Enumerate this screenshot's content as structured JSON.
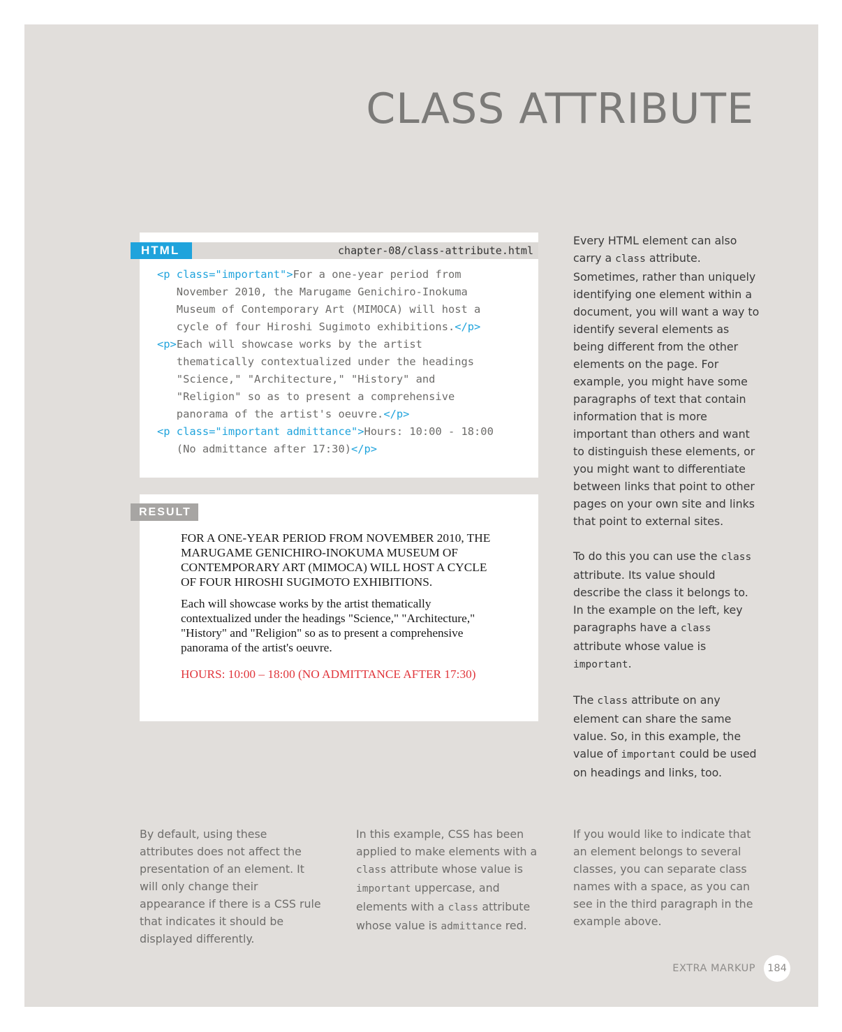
{
  "title": "CLASS ATTRIBUTE",
  "html_panel": {
    "label": "HTML",
    "filename": "chapter-08/class-attribute.html",
    "code_lines": [
      [
        {
          "t": "<p class=\"important\">",
          "tag": true
        },
        {
          "t": "For a one-year period from",
          "tag": false
        }
      ],
      [
        {
          "t": "   November 2010, the Marugame Genichiro-Inokuma",
          "tag": false
        }
      ],
      [
        {
          "t": "   Museum of Contemporary Art (MIMOCA) will host a",
          "tag": false
        }
      ],
      [
        {
          "t": "   cycle of four Hiroshi Sugimoto exhibitions.",
          "tag": false
        },
        {
          "t": "</p>",
          "tag": true
        }
      ],
      [
        {
          "t": "<p>",
          "tag": true
        },
        {
          "t": "Each will showcase works by the artist",
          "tag": false
        }
      ],
      [
        {
          "t": "   thematically contextualized under the headings",
          "tag": false
        }
      ],
      [
        {
          "t": "   \"Science,\" \"Architecture,\" \"History\" and",
          "tag": false
        }
      ],
      [
        {
          "t": "   \"Religion\" so as to present a comprehensive",
          "tag": false
        }
      ],
      [
        {
          "t": "   panorama of the artist's oeuvre.",
          "tag": false
        },
        {
          "t": "</p>",
          "tag": true
        }
      ],
      [
        {
          "t": "<p class=\"important admittance\">",
          "tag": true
        },
        {
          "t": "Hours: 10:00 - 18:00",
          "tag": false
        }
      ],
      [
        {
          "t": "   (No admittance after 17:30)",
          "tag": false
        },
        {
          "t": "</p>",
          "tag": true
        }
      ]
    ]
  },
  "result_panel": {
    "label": "RESULT",
    "para1": "For a one-year period from November 2010, the Marugame Genichiro-Inokuma Museum of Contemporary Art (MIMOCA) will host a cycle of four Hiroshi Sugimoto exhibitions.",
    "para2": "Each will showcase works by the artist thematically contextualized under the headings \"Science,\" \"Architecture,\" \"History\" and \"Religion\" so as to present a comprehensive panorama of the artist's oeuvre.",
    "para3": "Hours: 10:00 – 18:00 (No admittance after 17:30)",
    "para3_color": "#e0353b"
  },
  "side": {
    "p1": [
      {
        "t": "Every HTML element can also carry a ",
        "m": false
      },
      {
        "t": "class",
        "m": true
      },
      {
        "t": " attribute. Sometimes, rather than uniquely identifying one element within a document, you will want a way to identify several elements as being different from the other elements on the page. For example, you might have some paragraphs of text that contain information that is more important than others and want to distinguish these elements, or you might want to differentiate between links that point to other pages on your own site and links that point to external sites.",
        "m": false
      }
    ],
    "p2": [
      {
        "t": "To do this you can use the ",
        "m": false
      },
      {
        "t": "class",
        "m": true
      },
      {
        "t": " attribute. Its value should describe the class it belongs to. In the example on the left, key paragraphs have a ",
        "m": false
      },
      {
        "t": "class",
        "m": true
      },
      {
        "t": " attribute whose value is ",
        "m": false
      },
      {
        "t": "important",
        "m": true
      },
      {
        "t": ".",
        "m": false
      }
    ],
    "p3": [
      {
        "t": "The ",
        "m": false
      },
      {
        "t": "class",
        "m": true
      },
      {
        "t": " attribute on any element can share the same value. So, in this example, the value of ",
        "m": false
      },
      {
        "t": "important",
        "m": true
      },
      {
        "t": " could be used on headings and links, too.",
        "m": false
      }
    ]
  },
  "bottom": {
    "col1": [
      {
        "t": "By default, using these attributes does not affect the presentation of an element. It will only change their appearance if there is a CSS rule that indicates it should be displayed differently.",
        "m": false
      }
    ],
    "col2": [
      {
        "t": "In this example, CSS has been applied to make elements with a ",
        "m": false
      },
      {
        "t": "class",
        "m": true
      },
      {
        "t": " attribute whose value is ",
        "m": false
      },
      {
        "t": "important",
        "m": true
      },
      {
        "t": " uppercase, and elements with a ",
        "m": false
      },
      {
        "t": "class",
        "m": true
      },
      {
        "t": " attribute whose value is ",
        "m": false
      },
      {
        "t": "admittance",
        "m": true
      },
      {
        "t": " red.",
        "m": false
      }
    ],
    "col3": [
      {
        "t": "If you would like to indicate that an element belongs to several classes, you can separate class names with a space, as you can see in the third paragraph in the example above.",
        "m": false
      }
    ]
  },
  "footer": {
    "section": "EXTRA MARKUP",
    "page": "184"
  },
  "colors": {
    "page_bg": "#e1dedb",
    "html_label": "#1fa3dc",
    "result_label": "#a7a5a3",
    "code_tag": "#1fa3dc"
  }
}
